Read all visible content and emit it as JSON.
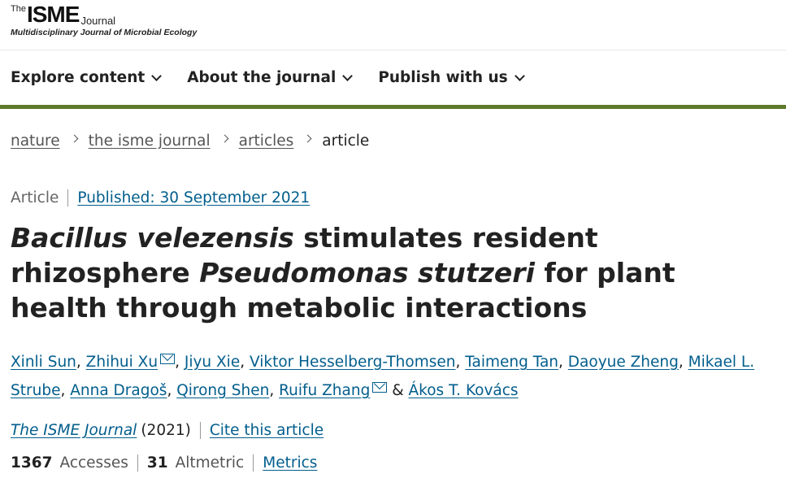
{
  "logo": {
    "the": "The",
    "isme": "ISME",
    "journal": "Journal",
    "tagline": "Multidisciplinary Journal of Microbial Ecology"
  },
  "nav": {
    "items": [
      {
        "label": "Explore content"
      },
      {
        "label": "About the journal"
      },
      {
        "label": "Publish with us"
      }
    ]
  },
  "breadcrumbs": {
    "items": [
      "nature",
      "the isme journal",
      "articles"
    ],
    "current": "article"
  },
  "article": {
    "type": "Article",
    "published": "Published: 30 September 2021",
    "title": {
      "part1_italic": "Bacillus velezensis",
      "part2": " stimulates resident rhizosphere ",
      "part3_italic": "Pseudomonas stutzeri",
      "part4": " for plant health through metabolic interactions"
    },
    "authors": [
      "Xinli Sun",
      "Zhihui Xu",
      "Jiyu Xie",
      "Viktor Hesselberg-Thomsen",
      "Taimeng Tan",
      "Daoyue Zheng",
      "Mikael L. Strube",
      "Anna Dragoš",
      "Qirong Shen",
      "Ruifu Zhang",
      "Ákos T. Kovács"
    ],
    "separators": {
      "comma": ", ",
      "amp": " & "
    },
    "journal_name": "The ISME Journal",
    "journal_year": "(2021)",
    "cite_label": "Cite this article"
  },
  "metrics": {
    "accesses_count": "1367",
    "accesses_label": "Accesses",
    "altmetric_count": "31",
    "altmetric_label": "Altmetric",
    "metrics_link": "Metrics"
  },
  "colors": {
    "link": "#025e8d",
    "nav_bar": "#5d7a2b"
  }
}
